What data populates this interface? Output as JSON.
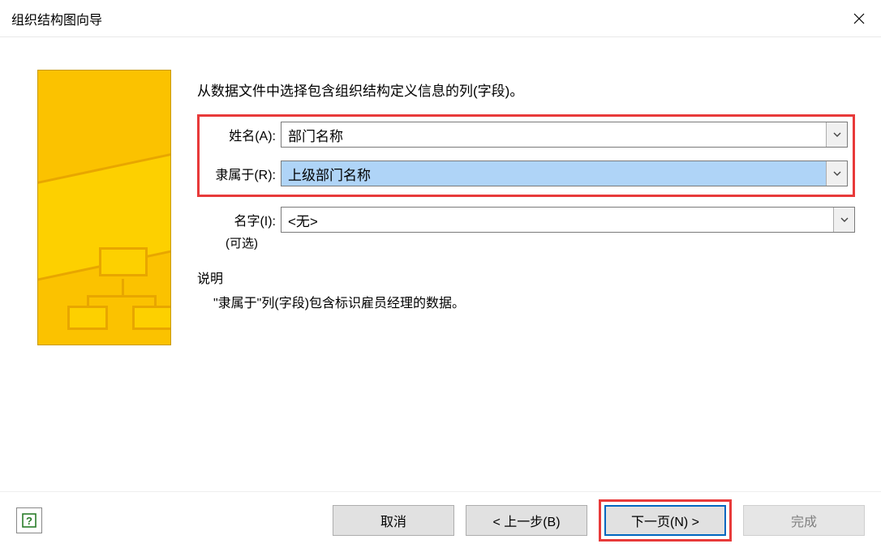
{
  "window": {
    "title": "组织结构图向导"
  },
  "instruction": "从数据文件中选择包含组织结构定义信息的列(字段)。",
  "fields": {
    "name_label": "姓名(A):",
    "name_value": "部门名称",
    "reports_label": "隶属于(R):",
    "reports_value": "上级部门名称",
    "first_label": "名字(I):",
    "first_optional": "(可选)",
    "first_value": "<无>"
  },
  "description": {
    "heading": "说明",
    "text": "\"隶属于\"列(字段)包含标识雇员经理的数据。"
  },
  "buttons": {
    "cancel": "取消",
    "back": "< 上一步(B)",
    "next": "下一页(N) >",
    "finish": "完成"
  }
}
